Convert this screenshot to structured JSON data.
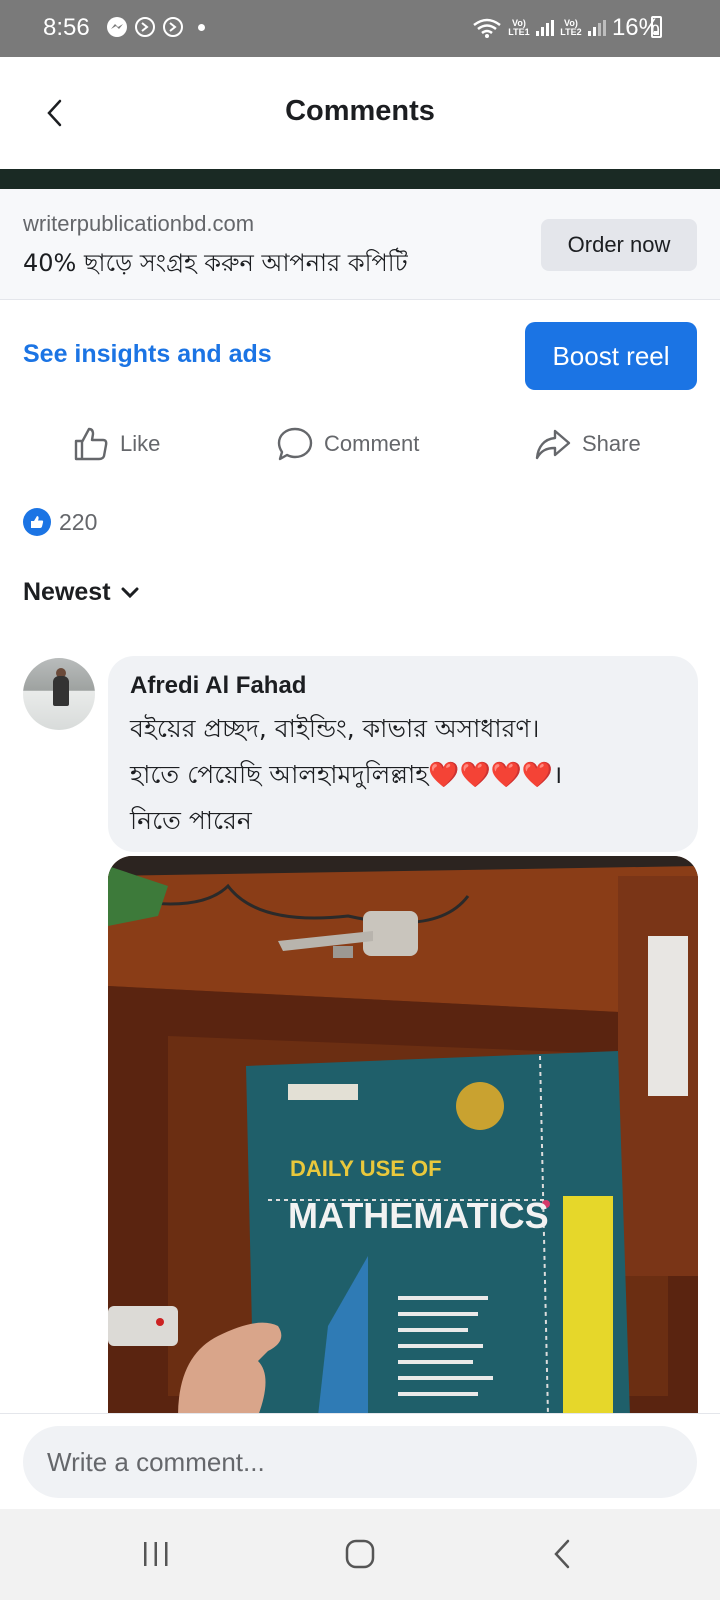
{
  "status_bar": {
    "time": "8:56",
    "sim1": "Vo) LTE1",
    "sim2": "Vo) LTE2",
    "battery": "16%"
  },
  "header": {
    "title": "Comments"
  },
  "ad": {
    "domain": "writerpublicationbd.com",
    "headline": "40% ছাড়ে সংগ্রহ করুন আপনার কপিটি",
    "cta_label": "Order now"
  },
  "promo": {
    "insights_label": "See insights and ads",
    "boost_label": "Boost reel"
  },
  "actions": {
    "like_label": "Like",
    "comment_label": "Comment",
    "share_label": "Share"
  },
  "reactions": {
    "count": "220"
  },
  "sort": {
    "label": "Newest"
  },
  "comment": {
    "author": "Afredi Al Fahad",
    "line1": "বইয়ের প্রচ্ছদ, বাইন্ডিং, কাভার অসাধারণ।",
    "line2": "হাতে পেয়েছি আলহামদুলিল্লাহ",
    "line2_hearts": "❤️❤️❤️❤️",
    "line2_end": "।",
    "line3": "নিতে পারেন"
  },
  "photo": {
    "book_title_top": "DAILY USE OF",
    "book_title_main": "MATHEMATICS"
  },
  "composer": {
    "placeholder": "Write a comment..."
  },
  "colors": {
    "accent": "#1b74e4",
    "status_bar": "#7a7a7a",
    "bubble": "#f0f2f5"
  }
}
